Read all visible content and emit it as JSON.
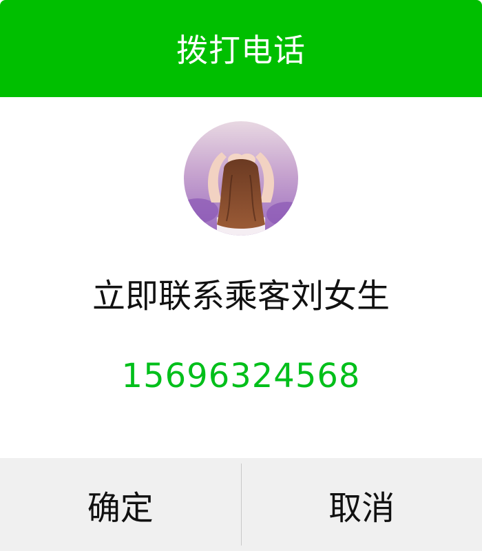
{
  "dialog": {
    "title": "拨打电话",
    "contact_text": "立即联系乘客刘女生",
    "phone_number": "15696324568",
    "confirm_label": "确定",
    "cancel_label": "取消"
  },
  "colors": {
    "header_bg": "#00bf00",
    "phone_text": "#00bf1a",
    "footer_bg": "#f0f0f0"
  }
}
